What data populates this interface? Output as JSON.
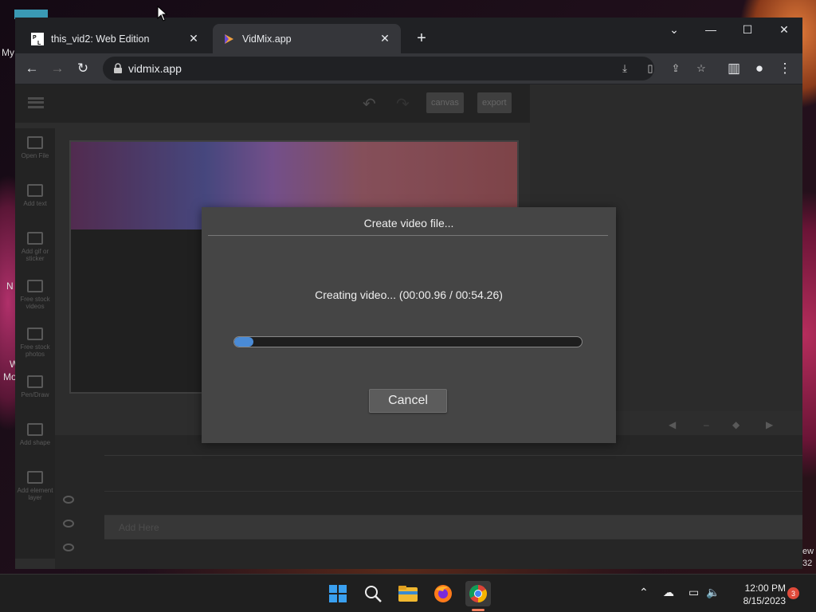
{
  "desktop": {
    "labels": [
      "My",
      "N",
      "W",
      "Mo",
      "ew",
      "32"
    ]
  },
  "browser": {
    "tabs": [
      {
        "title": "this_vid2: Web Edition",
        "active": false,
        "favicon": "pl-logo-icon"
      },
      {
        "title": "VidMix.app",
        "active": true,
        "favicon": "play-triangle-icon"
      }
    ],
    "new_tab_label": "+",
    "url": "vidmix.app",
    "window_controls": [
      "chevron-down-icon",
      "minimize-icon",
      "maximize-icon",
      "close-icon"
    ]
  },
  "app": {
    "toolbar_buttons": [
      "canvas",
      "export"
    ],
    "sidebar_items": [
      "Open File",
      "Add text",
      "Add gif or sticker",
      "Free stock videos",
      "Free stock photos",
      "Pen/Draw",
      "Add shape",
      "Add element layer"
    ],
    "timeline_track_label": "Add Here"
  },
  "dialog": {
    "title": "Create video file...",
    "status": "Creating video... (00:00.96 / 00:54.26)",
    "progress_fraction": 0.018,
    "cancel_label": "Cancel"
  },
  "taskbar": {
    "time": "12:00 PM",
    "date": "8/15/2023",
    "notification_count": "3",
    "icons": [
      "windows-start-icon",
      "search-icon",
      "file-explorer-icon",
      "firefox-icon",
      "chrome-icon"
    ]
  }
}
